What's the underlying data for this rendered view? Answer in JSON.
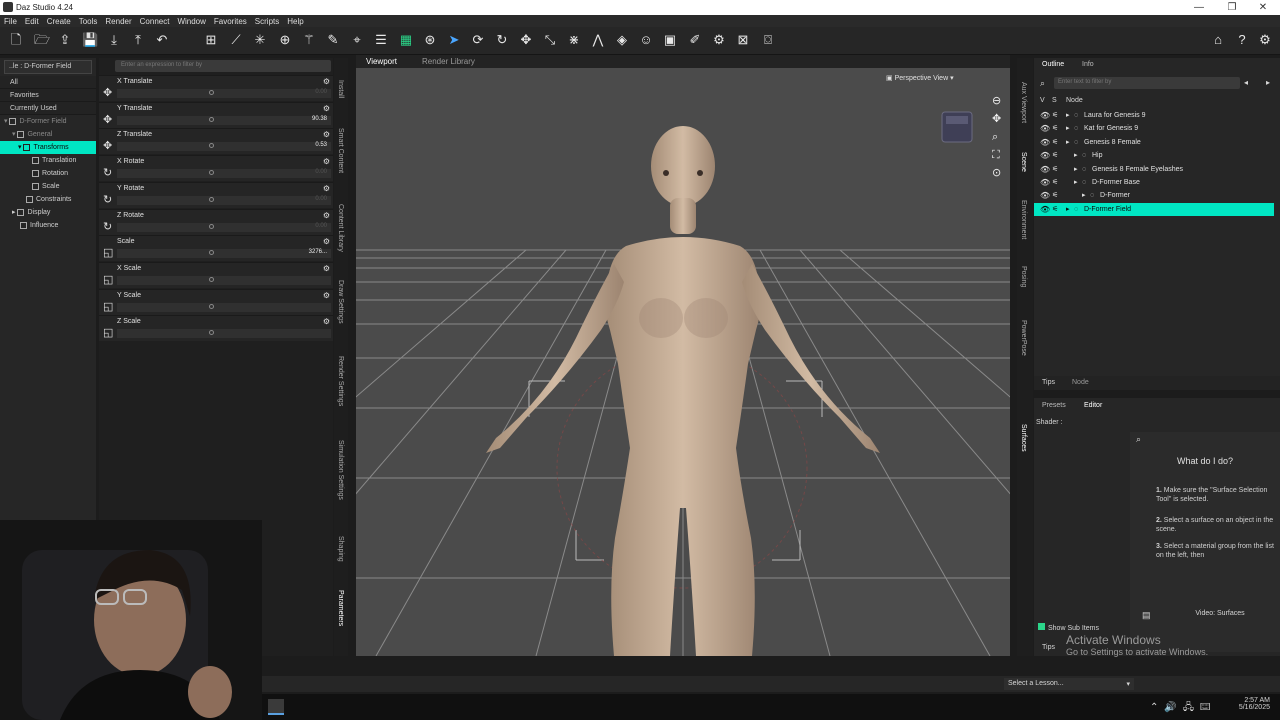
{
  "window": {
    "title": "Daz Studio 4.24"
  },
  "menu": [
    "File",
    "Edit",
    "Create",
    "Tools",
    "Render",
    "Connect",
    "Window",
    "Favorites",
    "Scripts",
    "Help"
  ],
  "left_tree": {
    "header": "..le : D-Former Field",
    "top_items": [
      "All",
      "Favorites",
      "Currently Used"
    ],
    "items": [
      {
        "label": "D-Former Field",
        "indent": 0
      },
      {
        "label": "General",
        "indent": 1
      },
      {
        "label": "Transforms",
        "indent": 2,
        "selected": true
      },
      {
        "label": "Translation",
        "indent": 3
      },
      {
        "label": "Rotation",
        "indent": 3
      },
      {
        "label": "Scale",
        "indent": 3
      },
      {
        "label": "Constraints",
        "indent": 2
      },
      {
        "label": "Display",
        "indent": 1
      },
      {
        "label": "Influence",
        "indent": 1
      }
    ]
  },
  "params": {
    "filter_placeholder": "Enter an expression to filter by",
    "rows": [
      {
        "label": "X Translate",
        "value": "0.00",
        "icon": "✥"
      },
      {
        "label": "Y Translate",
        "value": "90.38",
        "icon": "✥"
      },
      {
        "label": "Z Translate",
        "value": "0.53",
        "icon": "✥"
      },
      {
        "label": "X Rotate",
        "value": "0.00",
        "icon": "↻"
      },
      {
        "label": "Y Rotate",
        "value": "0.00",
        "icon": "↻"
      },
      {
        "label": "Z Rotate",
        "value": "0.00",
        "icon": "↻"
      },
      {
        "label": "Scale",
        "value": "3276...",
        "icon": "◱"
      },
      {
        "label": "X Scale",
        "value": "",
        "icon": "◱"
      },
      {
        "label": "Y Scale",
        "value": "",
        "icon": "◱"
      },
      {
        "label": "Z Scale",
        "value": "",
        "icon": "◱"
      }
    ]
  },
  "left_vtabs": [
    "Install",
    "Smart Content",
    "Content Library",
    "Draw Settings",
    "Render Settings",
    "Simulation Settings",
    "Shaping",
    "Parameters"
  ],
  "viewport": {
    "tabs": [
      "Viewport",
      "Render Library"
    ],
    "view": "Perspective View"
  },
  "right_vtabs": [
    "Aux Viewport",
    "Scene",
    "Environment",
    "Posing",
    "PowerPose",
    "Surfaces"
  ],
  "scene": {
    "tabs": [
      "Outline",
      "Info"
    ],
    "filter_placeholder": "Enter text to filter by",
    "columns": [
      "V",
      "S",
      "Node"
    ],
    "nodes": [
      {
        "label": "Laura for Genesis 9",
        "depth": 0
      },
      {
        "label": "Kat for Genesis 9",
        "depth": 0
      },
      {
        "label": "Genesis 8 Female",
        "depth": 0
      },
      {
        "label": "Hip",
        "depth": 1
      },
      {
        "label": "Genesis 8 Female Eyelashes",
        "depth": 1
      },
      {
        "label": "D-Former Base",
        "depth": 1
      },
      {
        "label": "D-Former",
        "depth": 2
      },
      {
        "label": "D-Former Field",
        "depth": 0,
        "selected": true
      }
    ],
    "bottom_tabs": [
      "Tips",
      "Node"
    ]
  },
  "surfaces": {
    "tabs": [
      "Presets",
      "Editor"
    ],
    "shader_label": "Shader :",
    "question": "What do I do?",
    "steps": [
      {
        "num": "1.",
        "text": "Make sure the \"Surface Selection Tool\" is selected."
      },
      {
        "num": "2.",
        "text": "Select a surface on an object in the scene."
      },
      {
        "num": "3.",
        "text": "Select a material group from the list on the left, then"
      }
    ],
    "video_button": "Video: Surfaces",
    "show_sub_items": "Show Sub Items",
    "tips_tab": "Tips"
  },
  "watermark": {
    "line1": "Activate Windows",
    "line2": "Go to Settings to activate Windows."
  },
  "lesson_select": "Select a Lesson...",
  "clock": {
    "time": "2:57 AM",
    "date": "5/16/2025"
  },
  "colors": {
    "accent": "#00e6c3"
  }
}
